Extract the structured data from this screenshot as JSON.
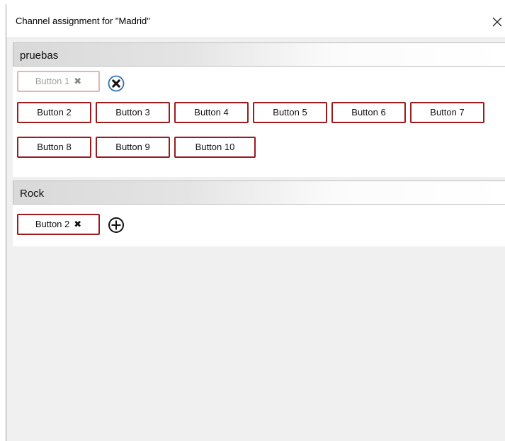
{
  "dialog": {
    "title": "Channel assignment for \"Madrid\""
  },
  "groups": [
    {
      "name": "pruebas",
      "assigned": [
        {
          "label": "Button 1",
          "remove": "✖",
          "state": "disabled"
        }
      ],
      "action_icon": "remove-circle-icon",
      "available": [
        {
          "label": "Button 2"
        },
        {
          "label": "Button 3"
        },
        {
          "label": "Button 4"
        },
        {
          "label": "Button 5"
        },
        {
          "label": "Button 6"
        },
        {
          "label": "Button 7"
        },
        {
          "label": "Button 8"
        },
        {
          "label": "Button 9"
        },
        {
          "label": "Button 10"
        }
      ]
    },
    {
      "name": "Rock",
      "assigned": [
        {
          "label": "Button 2",
          "remove": "✖"
        }
      ],
      "action_icon": "add-circle-icon"
    }
  ],
  "colors": {
    "chip_border": "#9b1c1c",
    "chip_border_disabled": "#e7b4b4",
    "remove_icon_ring": "#2f6fb5",
    "background": "#f0f0f0"
  }
}
